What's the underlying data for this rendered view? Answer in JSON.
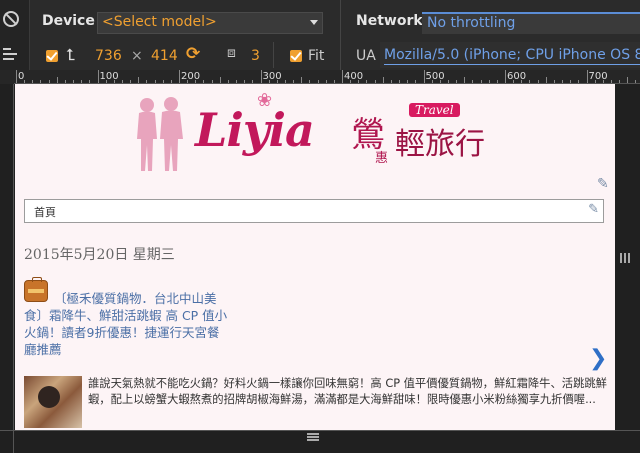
{
  "devtools": {
    "device_label": "Device",
    "device_select": "<Select model>",
    "network_label": "Network",
    "network_select": "No throttling",
    "width": "736",
    "times": "×",
    "height": "414",
    "scale": "3",
    "fit_label": "Fit",
    "ua_label": "UA",
    "ua_value": "Mozilla/5.0 (iPhone; CPU iPhone OS 8_",
    "ruler_labels": [
      "0",
      "100",
      "200",
      "300",
      "400",
      "500",
      "600",
      "700"
    ],
    "accent": "#f0a030",
    "link_color": "#6fa0e8"
  },
  "page": {
    "logo_latin": "Liyia",
    "logo_cn_bird": "鶯",
    "logo_cn_trip": "輕旅行",
    "logo_cn_small": "惠",
    "logo_travel": "Travel",
    "nav_label": "首頁",
    "date": "2015年5月20日 星期三",
    "post_title": "〔極禾優質鍋物．台北中山美食〕霜降牛、鮮甜活跳蝦 高 CP 值小火鍋！讀者9折優惠！捷運行天宮餐廳推薦",
    "excerpt": "誰說天氣熱就不能吃火鍋？好料火鍋一樣讓你回味無窮！高 CP 值平價優質鍋物，鮮紅霜降牛、活跳跳鮮蝦，配上以螃蟹大蝦熬煮的招牌胡椒海鮮湯，滿滿都是大海鮮甜味！限時優惠小米粉絲獨享九折價喔...",
    "next_arrow": "❯",
    "title_color": "#4b6fa6",
    "logo_color": "#c2185b"
  }
}
